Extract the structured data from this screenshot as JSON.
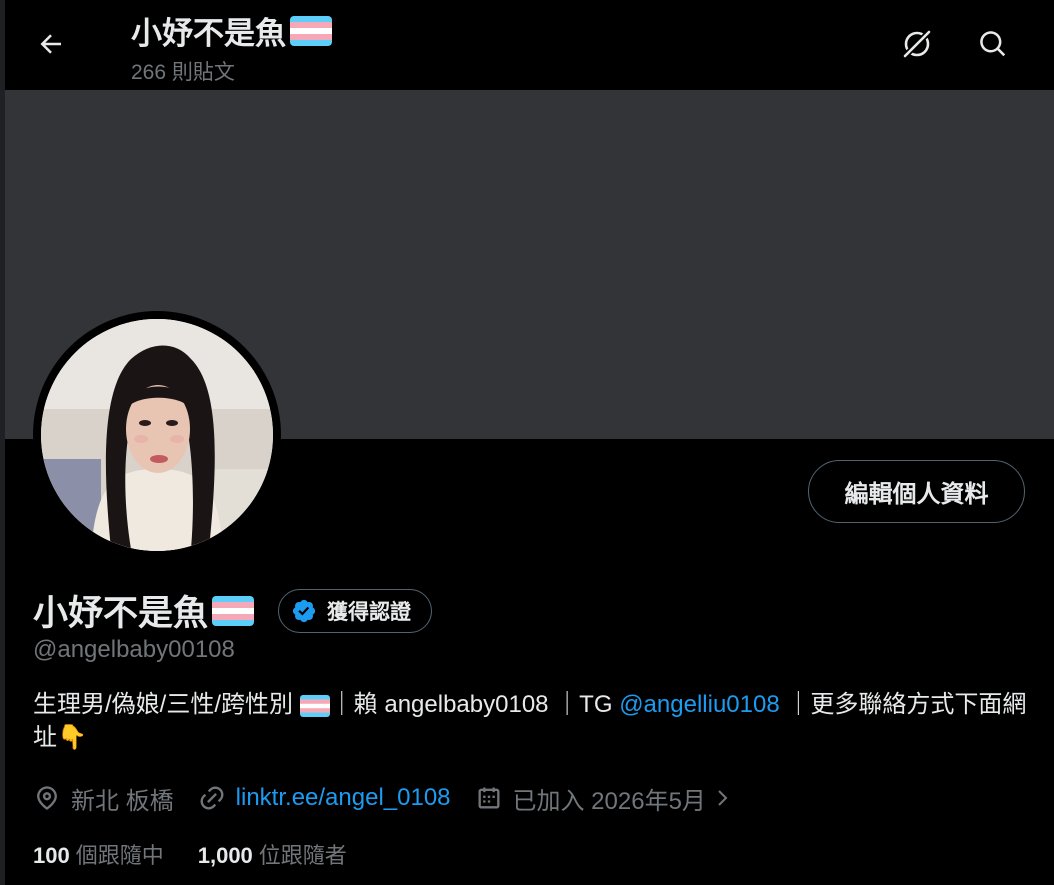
{
  "header": {
    "title": "小妤不是魚",
    "post_count": "266 則貼文"
  },
  "profile": {
    "edit_button": "編輯個人資料",
    "name": "小妤不是魚",
    "verify_label": "獲得認證",
    "handle": "@angelbaby00108",
    "bio": {
      "part1": "生理男/偽娘/三性/跨性別",
      "part2": "｜賴 angelbaby0108 ｜TG ",
      "mention": "@angelliu0108",
      "part3": " ｜更多聯絡方式下面網址",
      "emoji": "👇"
    },
    "location": "新北 板橋",
    "link": "linktr.ee/angel_0108",
    "joined": "已加入 2026年5月",
    "following_count": "100",
    "following_label": "個跟隨中",
    "followers_count": "1,000",
    "followers_label": "位跟隨者"
  },
  "icons": {
    "back": "arrow-left-icon",
    "grok": "grok-icon",
    "search": "search-icon",
    "verified": "verified-badge-icon",
    "location": "location-pin-icon",
    "link": "link-icon",
    "calendar": "calendar-icon",
    "chevron": "chevron-right-icon",
    "flag": "transgender-flag-icon"
  },
  "colors": {
    "background": "#000000",
    "banner": "#333438",
    "accent": "#1d9bf0",
    "muted_text": "#71767b",
    "text": "#e7e9ea",
    "flag_blue": "#5bcefa",
    "flag_pink": "#f5a9b8",
    "flag_white": "#ffffff"
  }
}
